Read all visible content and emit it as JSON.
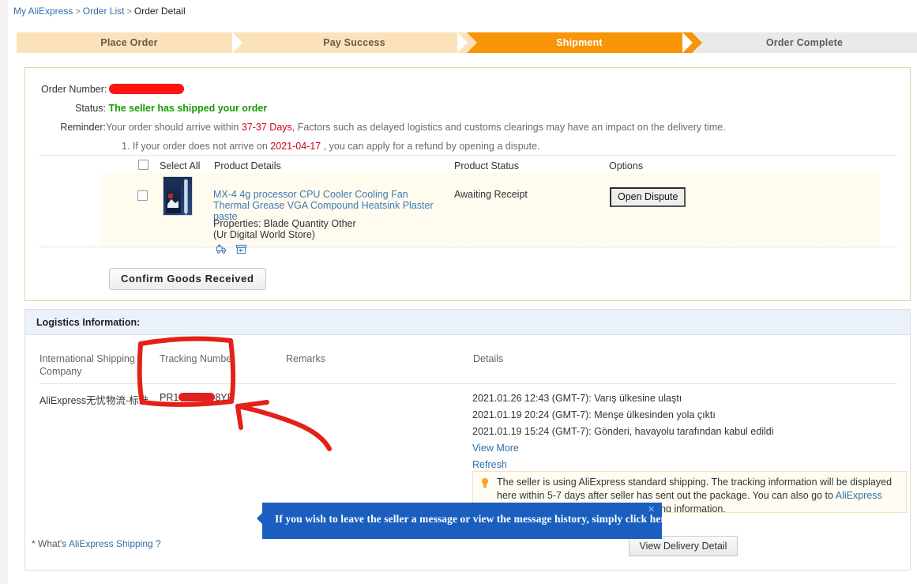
{
  "breadcrumb": {
    "items": [
      {
        "label": "My AliExpress",
        "link": true
      },
      {
        "label": "Order List",
        "link": true
      },
      {
        "label": "Order Detail",
        "link": false
      }
    ],
    "separator": ">"
  },
  "steps": [
    {
      "label": "Place Order",
      "state": "done"
    },
    {
      "label": "Pay Success",
      "state": "done"
    },
    {
      "label": "Shipment",
      "state": "current"
    },
    {
      "label": "Order Complete",
      "state": "todo"
    }
  ],
  "colors": {
    "step_done": "#fbe2bb",
    "step_current": "#f89407",
    "step_todo": "#e9e9e9",
    "status_green": "#159c00",
    "link_blue": "#2f6fa8",
    "annotation_red": "#e02020",
    "tooltip_blue": "#1a5fc0",
    "logistics_header": "#eaf1fb",
    "product_row": "#fffbef"
  },
  "order": {
    "number_label": "Order Number:",
    "number_value": "",
    "number_redacted": true,
    "status_label": "Status:",
    "status_value": "The seller has shipped your order",
    "reminder_label": "Reminder:",
    "reminder_pre": "Your order should arrive within ",
    "reminder_days": "37-37 Days",
    "reminder_post": ", Factors such as delayed logistics and customs clearings may have an impact on the delivery time.",
    "refund_pre": "1. If your order does not arrive on ",
    "refund_date": "2021-04-17",
    "refund_post": " , you can apply for a refund by opening a dispute."
  },
  "product_table": {
    "headers": {
      "select_all": "Select All",
      "product_details": "Product Details",
      "product_status": "Product Status",
      "options": "Options"
    },
    "row": {
      "title": "MX-4 4g processor CPU Cooler Cooling Fan Thermal Grease VGA Compound Heatsink Plaster paste",
      "properties": "Properties: Blade Quantity Other",
      "store": "(Ur Digital World Store)",
      "status": "Awaiting Receipt",
      "option_button": "Open Dispute",
      "icons": [
        "truck-icon",
        "return-box-icon"
      ]
    }
  },
  "confirm_button": "Confirm Goods Received",
  "logistics": {
    "heading": "Logistics Information:",
    "columns": {
      "company": "International Shipping Company",
      "tracking": "Tracking Number",
      "remarks": "Remarks",
      "details": "Details"
    },
    "row": {
      "company": "AliExpress无忧物流-标准",
      "tracking_prefix": "PR1",
      "tracking_suffix": "8YP",
      "tracking_redacted": true,
      "remarks": ""
    },
    "events": [
      "2021.01.26 12:43 (GMT-7): Varış ülkesine ulaştı",
      "2021.01.19 20:24 (GMT-7): Menşe ülkesinden yola çıktı",
      "2021.01.19 15:24 (GMT-7): Gönderi, havayolu tarafından kabul edildi"
    ],
    "view_more": "View More",
    "refresh": "Refresh",
    "tip": {
      "line1": "The seller is using AliExpress standard shipping. The tracking information will be displayed",
      "line2": "here within 5-7 days after seller has sent out the package. You can also go to ",
      "link": "AliExpress",
      "line3": "Standard Shipping to check the tracking information."
    },
    "whats_pre": "* What's ",
    "whats_link": "AliExpress Shipping",
    "whats_post": " ?",
    "delivery_button": "View Delivery Detail"
  },
  "tooltip": {
    "text": "If you wish to leave the seller a message or view the message history, simply click here.",
    "close": "×"
  },
  "annotation": {
    "type": "red-hand-drawn-highlight",
    "target": "Tracking Number column"
  }
}
